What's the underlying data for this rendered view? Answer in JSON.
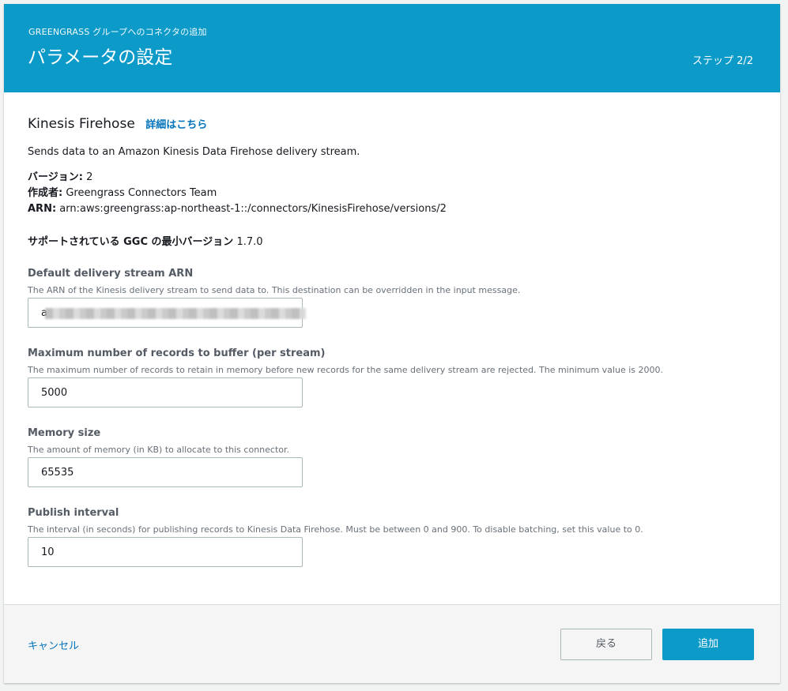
{
  "header": {
    "eyebrow": "GREENGRASS グループへのコネクタの追加",
    "title": "パラメータの設定",
    "step": "ステップ 2/2"
  },
  "connector": {
    "name": "Kinesis Firehose",
    "learn_more": "詳細はこちら",
    "description": "Sends data to an Amazon Kinesis Data Firehose delivery stream.",
    "version_label": "バージョン:",
    "version_value": "2",
    "author_label": "作成者:",
    "author_value": "Greengrass Connectors Team",
    "arn_label": "ARN:",
    "arn_value": "arn:aws:greengrass:ap-northeast-1::/connectors/KinesisFirehose/versions/2",
    "min_ggc_label": "サポートされている GGC の最小バージョン",
    "min_ggc_value": "1.7.0"
  },
  "fields": [
    {
      "label": "Default delivery stream ARN",
      "help": "The ARN of the Kinesis delivery stream to send data to. This destination can be overridden in the input message.",
      "value": "a"
    },
    {
      "label": "Maximum number of records to buffer (per stream)",
      "help": "The maximum number of records to retain in memory before new records for the same delivery stream are rejected. The minimum value is 2000.",
      "value": "5000"
    },
    {
      "label": "Memory size",
      "help": "The amount of memory (in KB) to allocate to this connector.",
      "value": "65535"
    },
    {
      "label": "Publish interval",
      "help": "The interval (in seconds) for publishing records to Kinesis Data Firehose. Must be between 0 and 900. To disable batching, set this value to 0.",
      "value": "10"
    }
  ],
  "footer": {
    "cancel": "キャンセル",
    "back": "戻る",
    "add": "追加"
  },
  "colors": {
    "header_bg": "#0c9ac9",
    "link": "#0073bb",
    "primary_button": "#0c9ac9"
  }
}
